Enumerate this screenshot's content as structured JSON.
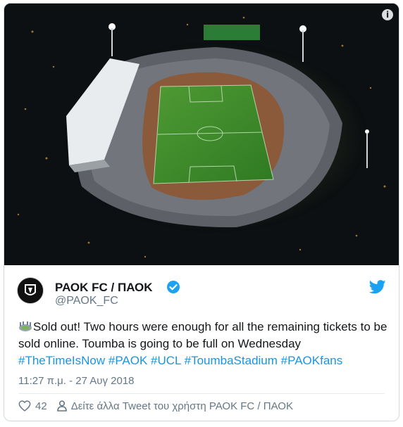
{
  "media": {
    "alt": "Aerial night view of Toumba Stadium",
    "info_icon": "info-icon"
  },
  "author": {
    "display_name": "ΡΑΟΚ FC / ΠΑΟΚ",
    "handle": "@PAOK_FC",
    "verified": true,
    "avatar_icon": "club-crest-icon"
  },
  "brand": {
    "icon": "twitter-bird-icon",
    "color": "#1da1f2"
  },
  "tweet": {
    "emoji": "stadium-emoji",
    "text_part1": "Sold out! Two hours were enough for all the remaining tickets to be sold online. Toumba is going to be full on Wednesday ",
    "hashtags": [
      "#TheTimeIsNow",
      "#PAOK",
      "#UCL",
      "#ToumbaStadium",
      "#PAOKfans"
    ],
    "hashtag_color": "#1b95e0"
  },
  "meta": {
    "timestamp": "11:27 π.μ. - 27 Αυγ 2018"
  },
  "actions": {
    "like_count": "42",
    "view_more_label": "Δείτε άλλα Tweet του χρήστη ΡΑΟΚ FC / ΠΑΟΚ"
  },
  "colors": {
    "text": "#14171a",
    "secondary": "#657786",
    "border": "#cfd9de"
  }
}
